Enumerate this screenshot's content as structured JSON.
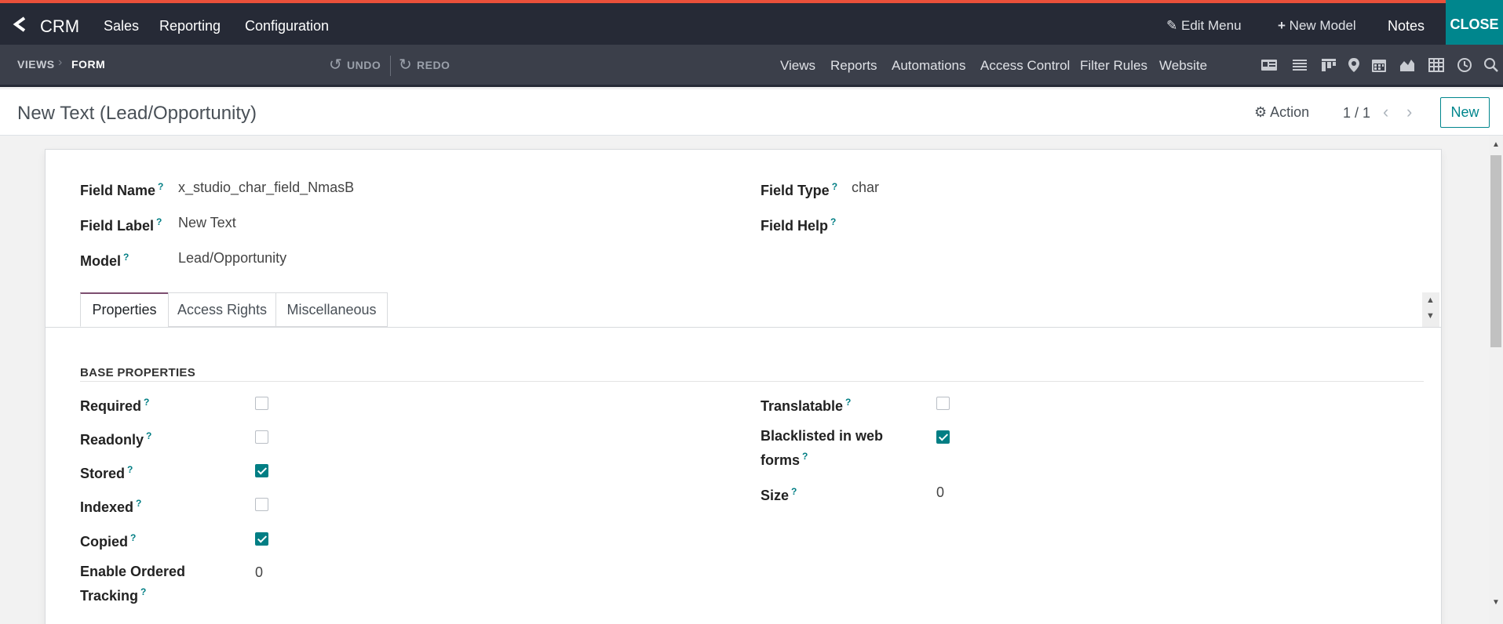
{
  "topbar": {
    "app": "CRM",
    "menu": [
      "Sales",
      "Reporting",
      "Configuration"
    ],
    "edit_menu": "Edit Menu",
    "new_model": "New Model",
    "notes": "Notes",
    "close": "CLOSE"
  },
  "subbar": {
    "breadcrumb": [
      "VIEWS",
      "FORM"
    ],
    "undo": "UNDO",
    "redo": "REDO",
    "links": [
      "Views",
      "Reports",
      "Automations",
      "Access Control",
      "Filter Rules",
      "Website"
    ],
    "view_icons": [
      "form-icon",
      "list-icon",
      "kanban-icon",
      "map-icon",
      "calendar-icon",
      "graph-icon",
      "pivot-icon",
      "activity-icon",
      "search-icon"
    ]
  },
  "control_panel": {
    "title": "New Text (Lead/Opportunity)",
    "action": "Action",
    "pager": "1 / 1",
    "new_button": "New"
  },
  "form": {
    "field_name_label": "Field Name",
    "field_name": "x_studio_char_field_NmasB",
    "field_label_label": "Field Label",
    "field_label": "New Text",
    "model_label": "Model",
    "model": "Lead/Opportunity",
    "field_type_label": "Field Type",
    "field_type": "char",
    "field_help_label": "Field Help",
    "help_mark": "?"
  },
  "tabs": [
    "Properties",
    "Access Rights",
    "Miscellaneous"
  ],
  "base_properties": {
    "section_title": "BASE PROPERTIES",
    "required": {
      "label": "Required",
      "checked": false
    },
    "readonly": {
      "label": "Readonly",
      "checked": false
    },
    "stored": {
      "label": "Stored",
      "checked": true
    },
    "indexed": {
      "label": "Indexed",
      "checked": false
    },
    "copied": {
      "label": "Copied",
      "checked": true
    },
    "ordered_tracking": {
      "label_line1": "Enable Ordered",
      "label_line2": "Tracking",
      "value": "0"
    },
    "translatable": {
      "label": "Translatable",
      "checked": false
    },
    "blacklisted": {
      "label_line1": "Blacklisted in web",
      "label_line2": "forms",
      "checked": true
    },
    "size": {
      "label": "Size",
      "value": "0"
    }
  },
  "colors": {
    "accent": "#017e84",
    "topbar": "#262a36",
    "close": "#00868d",
    "top_stripe": "#e9503a"
  }
}
